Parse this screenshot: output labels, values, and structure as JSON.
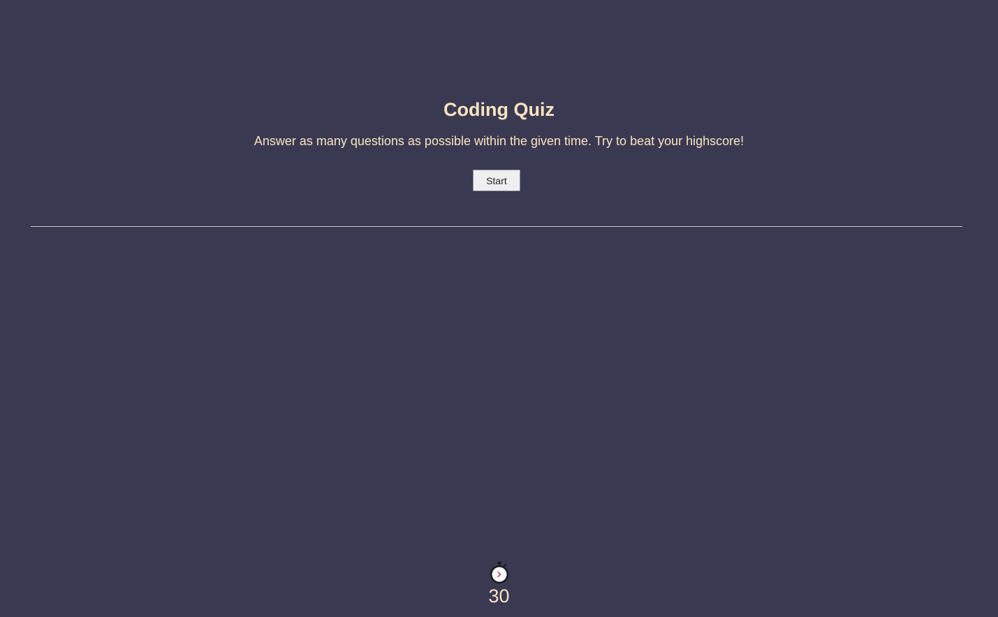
{
  "header": {
    "title": "Coding Quiz",
    "description": "Answer as many questions as possible within the given time. Try to beat your highscore!"
  },
  "controls": {
    "start_label": "Start"
  },
  "timer": {
    "icon": "stopwatch-icon",
    "seconds": "30"
  },
  "colors": {
    "background": "#393a51",
    "text_accent": "#fbe2c1"
  }
}
